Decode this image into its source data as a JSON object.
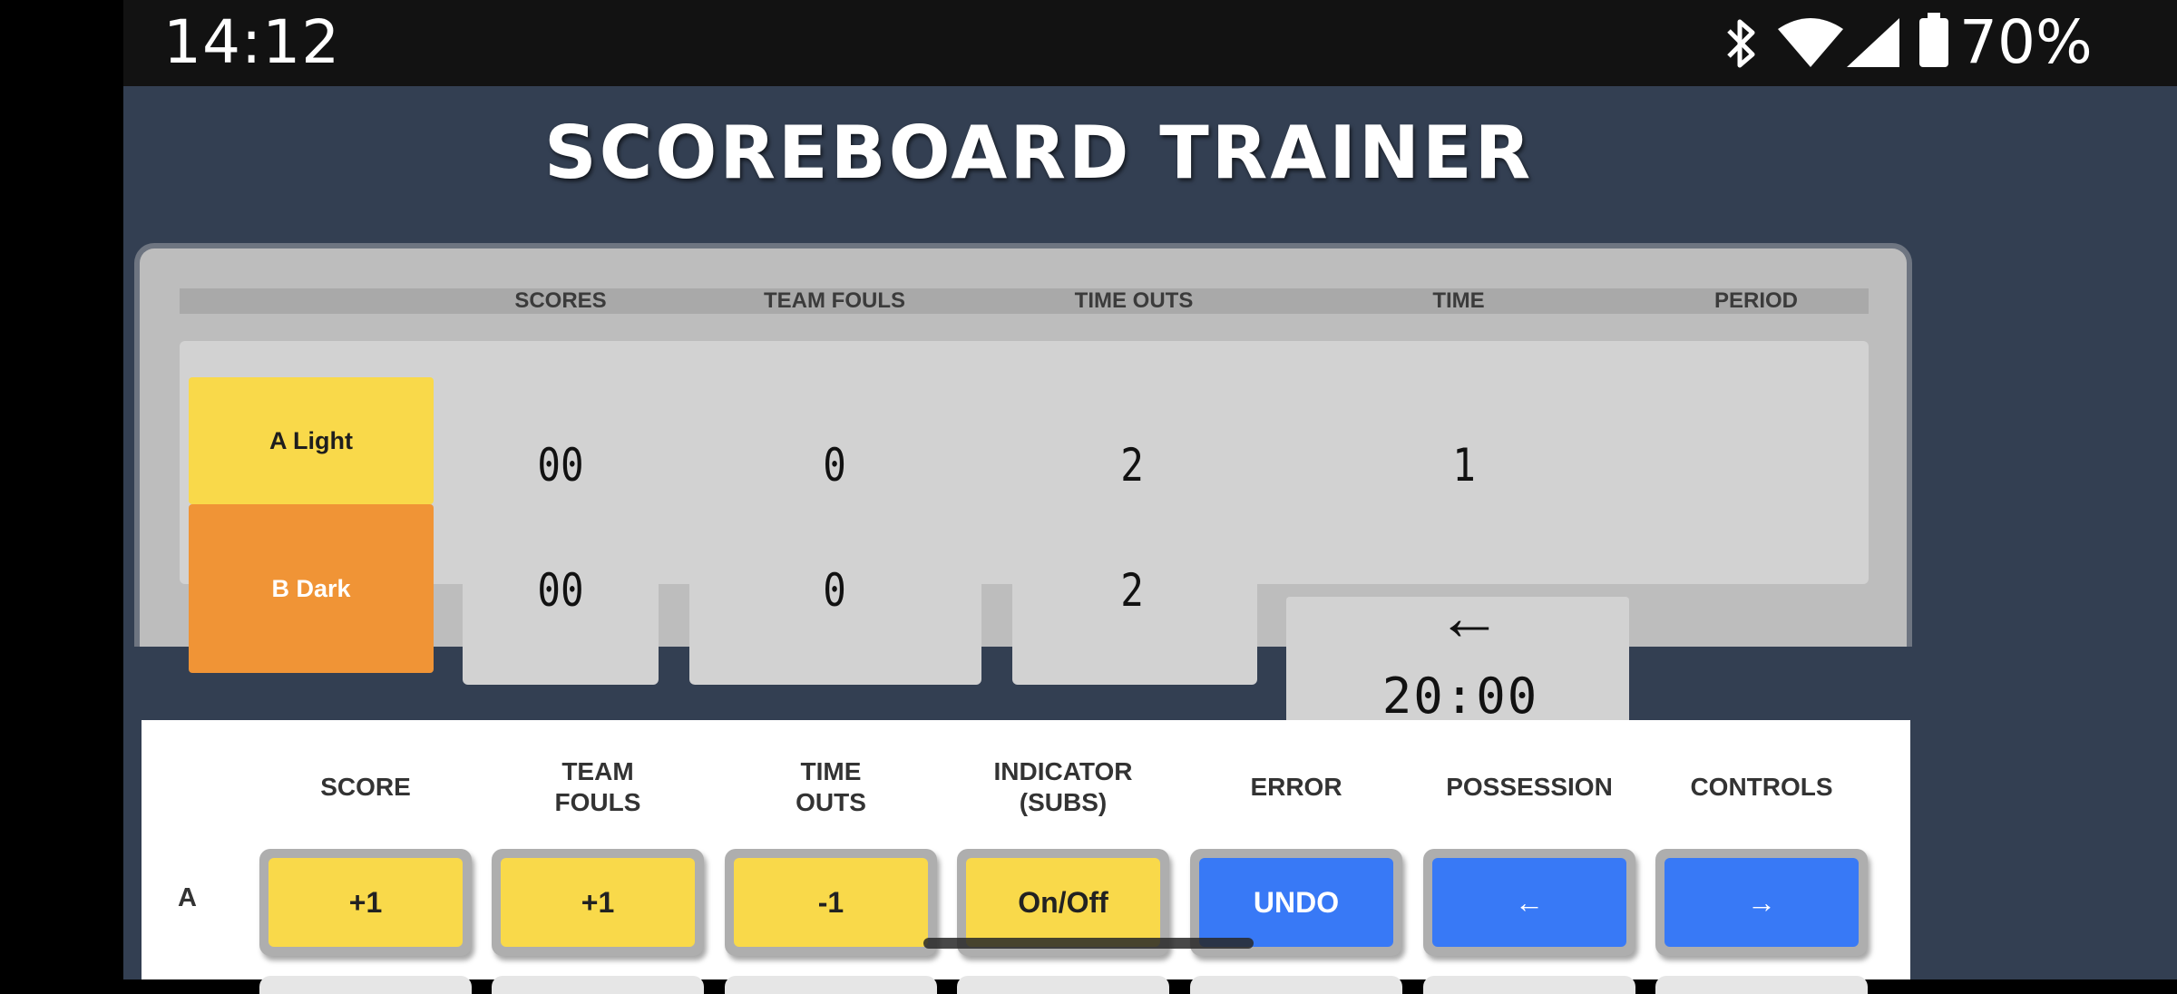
{
  "status_bar": {
    "time": "14:12",
    "battery": "70%"
  },
  "app": {
    "title": "SCOREBOARD TRAINER"
  },
  "board": {
    "headers": {
      "scores": "SCORES",
      "team_fouls": "TEAM FOULS",
      "time_outs": "TIME OUTS",
      "time": "TIME",
      "period": "PERIOD"
    },
    "team_a": {
      "name": "A Light",
      "score": "00",
      "team_fouls": "0",
      "time_outs": "2",
      "period": "1"
    },
    "team_b": {
      "name": "B Dark",
      "score": "00",
      "team_fouls": "0",
      "time_outs": "2"
    },
    "possession_arrow": "←",
    "clock": "20:00"
  },
  "controls": {
    "headers": {
      "score": "SCORE",
      "team_fouls_1": "TEAM",
      "team_fouls_2": "FOULS",
      "time_outs_1": "TIME",
      "time_outs_2": "OUTS",
      "indicator_1": "INDICATOR",
      "indicator_2": "(SUBS)",
      "error": "ERROR",
      "possession": "POSSESSION",
      "controls": "CONTROLS"
    },
    "row_a": {
      "label": "A",
      "score": "+1",
      "team_fouls": "+1",
      "time_outs": "-1",
      "indicator": "On/Off",
      "error": "UNDO",
      "possession": "←",
      "controls": "→"
    }
  },
  "colors": {
    "team_a": "#f9d94a",
    "team_b": "#f09436",
    "action_blue": "#3879f6",
    "background": "#333f52"
  }
}
